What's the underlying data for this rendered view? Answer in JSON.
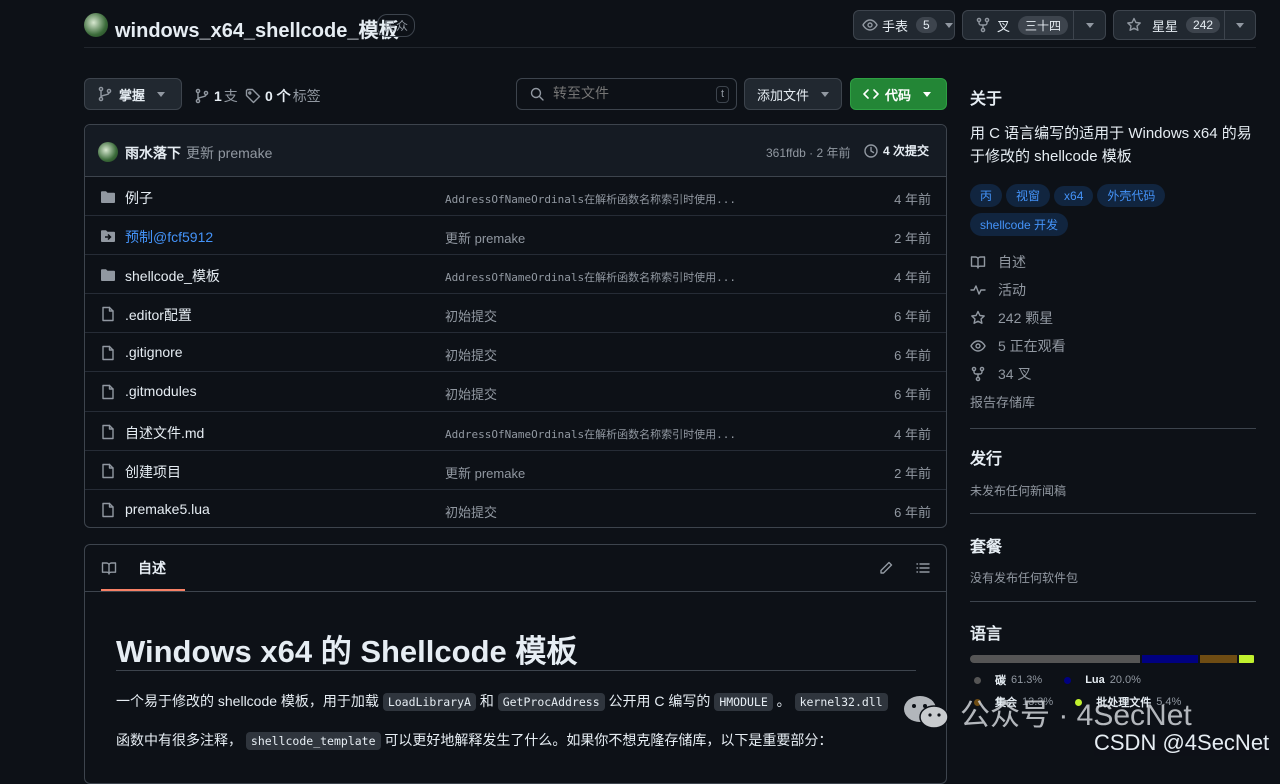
{
  "repo": {
    "name": "windows_x64_shellcode_模板",
    "visibility": "民众"
  },
  "actions": {
    "watch": {
      "label": "手表",
      "count": "5"
    },
    "fork": {
      "label": "叉",
      "count": "三十四"
    },
    "star": {
      "label": "星星",
      "count": "242"
    }
  },
  "toolbar": {
    "branch": "掌握",
    "branches_count": "1",
    "branches_label": "支",
    "tags_count": "0 个",
    "tags_label": "标签",
    "search_placeholder": "转至文件",
    "search_key": "t",
    "add_file": "添加文件",
    "code": "代码"
  },
  "commit": {
    "author": "雨水落下",
    "message": "更新 premake",
    "hash_time": "361ffdb · 2 年前",
    "commits": "4 次提交"
  },
  "files": [
    {
      "name": "例子",
      "type": "folder",
      "message": "AddressOfNameOrdinals在解析函数名称索引时使用...",
      "time": "4 年前",
      "mono": true
    },
    {
      "name": "预制@fcf5912",
      "type": "submodule",
      "message": "更新 premake",
      "time": "2 年前",
      "mono": false
    },
    {
      "name": "shellcode_模板",
      "type": "folder",
      "message": "AddressOfNameOrdinals在解析函数名称索引时使用...",
      "time": "4 年前",
      "mono": true
    },
    {
      "name": ".editor配置",
      "type": "file",
      "message": "初始提交",
      "time": "6 年前",
      "mono": false
    },
    {
      "name": ".gitignore",
      "type": "file",
      "message": "初始提交",
      "time": "6 年前",
      "mono": false
    },
    {
      "name": ".gitmodules",
      "type": "file",
      "message": "初始提交",
      "time": "6 年前",
      "mono": false
    },
    {
      "name": "自述文件.md",
      "type": "file",
      "message": "AddressOfNameOrdinals在解析函数名称索引时使用...",
      "time": "4 年前",
      "mono": true
    },
    {
      "name": "创建项目",
      "type": "file",
      "message": "更新 premake",
      "time": "2 年前",
      "mono": false
    },
    {
      "name": "premake5.lua",
      "type": "file",
      "message": "初始提交",
      "time": "6 年前",
      "mono": false
    }
  ],
  "readme": {
    "tab": "自述",
    "heading": "Windows x64 的 Shellcode 模板",
    "p1_a": "一个易于修改的 shellcode 模板，用于加载",
    "p1_code1": "LoadLibraryA",
    "p1_b": "和",
    "p1_code2": "GetProcAddress",
    "p1_c": "公开用 C 编写的",
    "p1_code3": "HMODULE",
    "p1_d": "。",
    "p1_code4": "kernel32.dll",
    "p2_a": "函数中有很多注释，",
    "p2_code": "shellcode_template",
    "p2_b": "可以更好地解释发生了什么。如果你不想克隆存储库，以下是重要部分："
  },
  "sidebar": {
    "about_title": "关于",
    "description": "用 C 语言编写的适用于 Windows x64 的易于修改的 shellcode 模板",
    "topics": [
      "丙",
      "视窗",
      "x64",
      "外壳代码",
      "shellcode 开发"
    ],
    "links": [
      {
        "icon": "book-icon",
        "text": "自述"
      },
      {
        "icon": "pulse-icon",
        "text": "活动"
      },
      {
        "icon": "star-icon",
        "text": "242 颗星"
      },
      {
        "icon": "eye-icon",
        "text": "5 正在观看"
      },
      {
        "icon": "fork-icon",
        "text": "34 叉"
      }
    ],
    "report": "报告存储库",
    "releases_title": "发行",
    "releases_text": "未发布任何新闻稿",
    "packages_title": "套餐",
    "packages_text": "没有发布任何软件包",
    "languages_title": "语言",
    "languages": [
      {
        "name": "碳",
        "percent": "61.3%",
        "color": "#555555",
        "value": 61.3
      },
      {
        "name": "Lua",
        "percent": "20.0%",
        "color": "#000080",
        "value": 20.0
      },
      {
        "name": "集会",
        "percent": "13.3%",
        "color": "#6E4C13",
        "value": 13.3
      },
      {
        "name": "批处理文件",
        "percent": "5.4%",
        "color": "#C1F12E",
        "value": 5.4
      }
    ]
  },
  "watermark": {
    "wechat": "公众号 · 4SecNet",
    "csdn": "CSDN @4SecNet"
  }
}
